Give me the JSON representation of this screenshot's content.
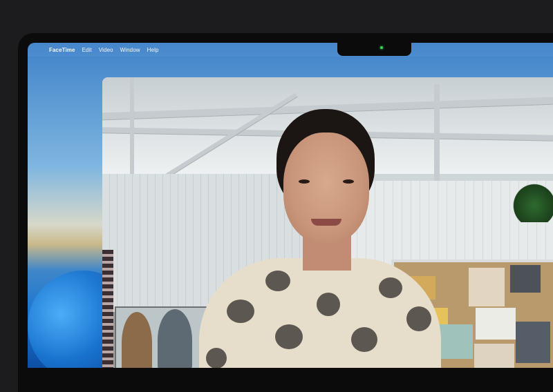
{
  "menubar": {
    "apple_icon": "apple-icon",
    "app_name": "FaceTime",
    "items": [
      "Edit",
      "Video",
      "Window",
      "Help"
    ]
  },
  "camera": {
    "indicator_color": "#39d353"
  },
  "video": {
    "type": "facetime-call-video"
  }
}
